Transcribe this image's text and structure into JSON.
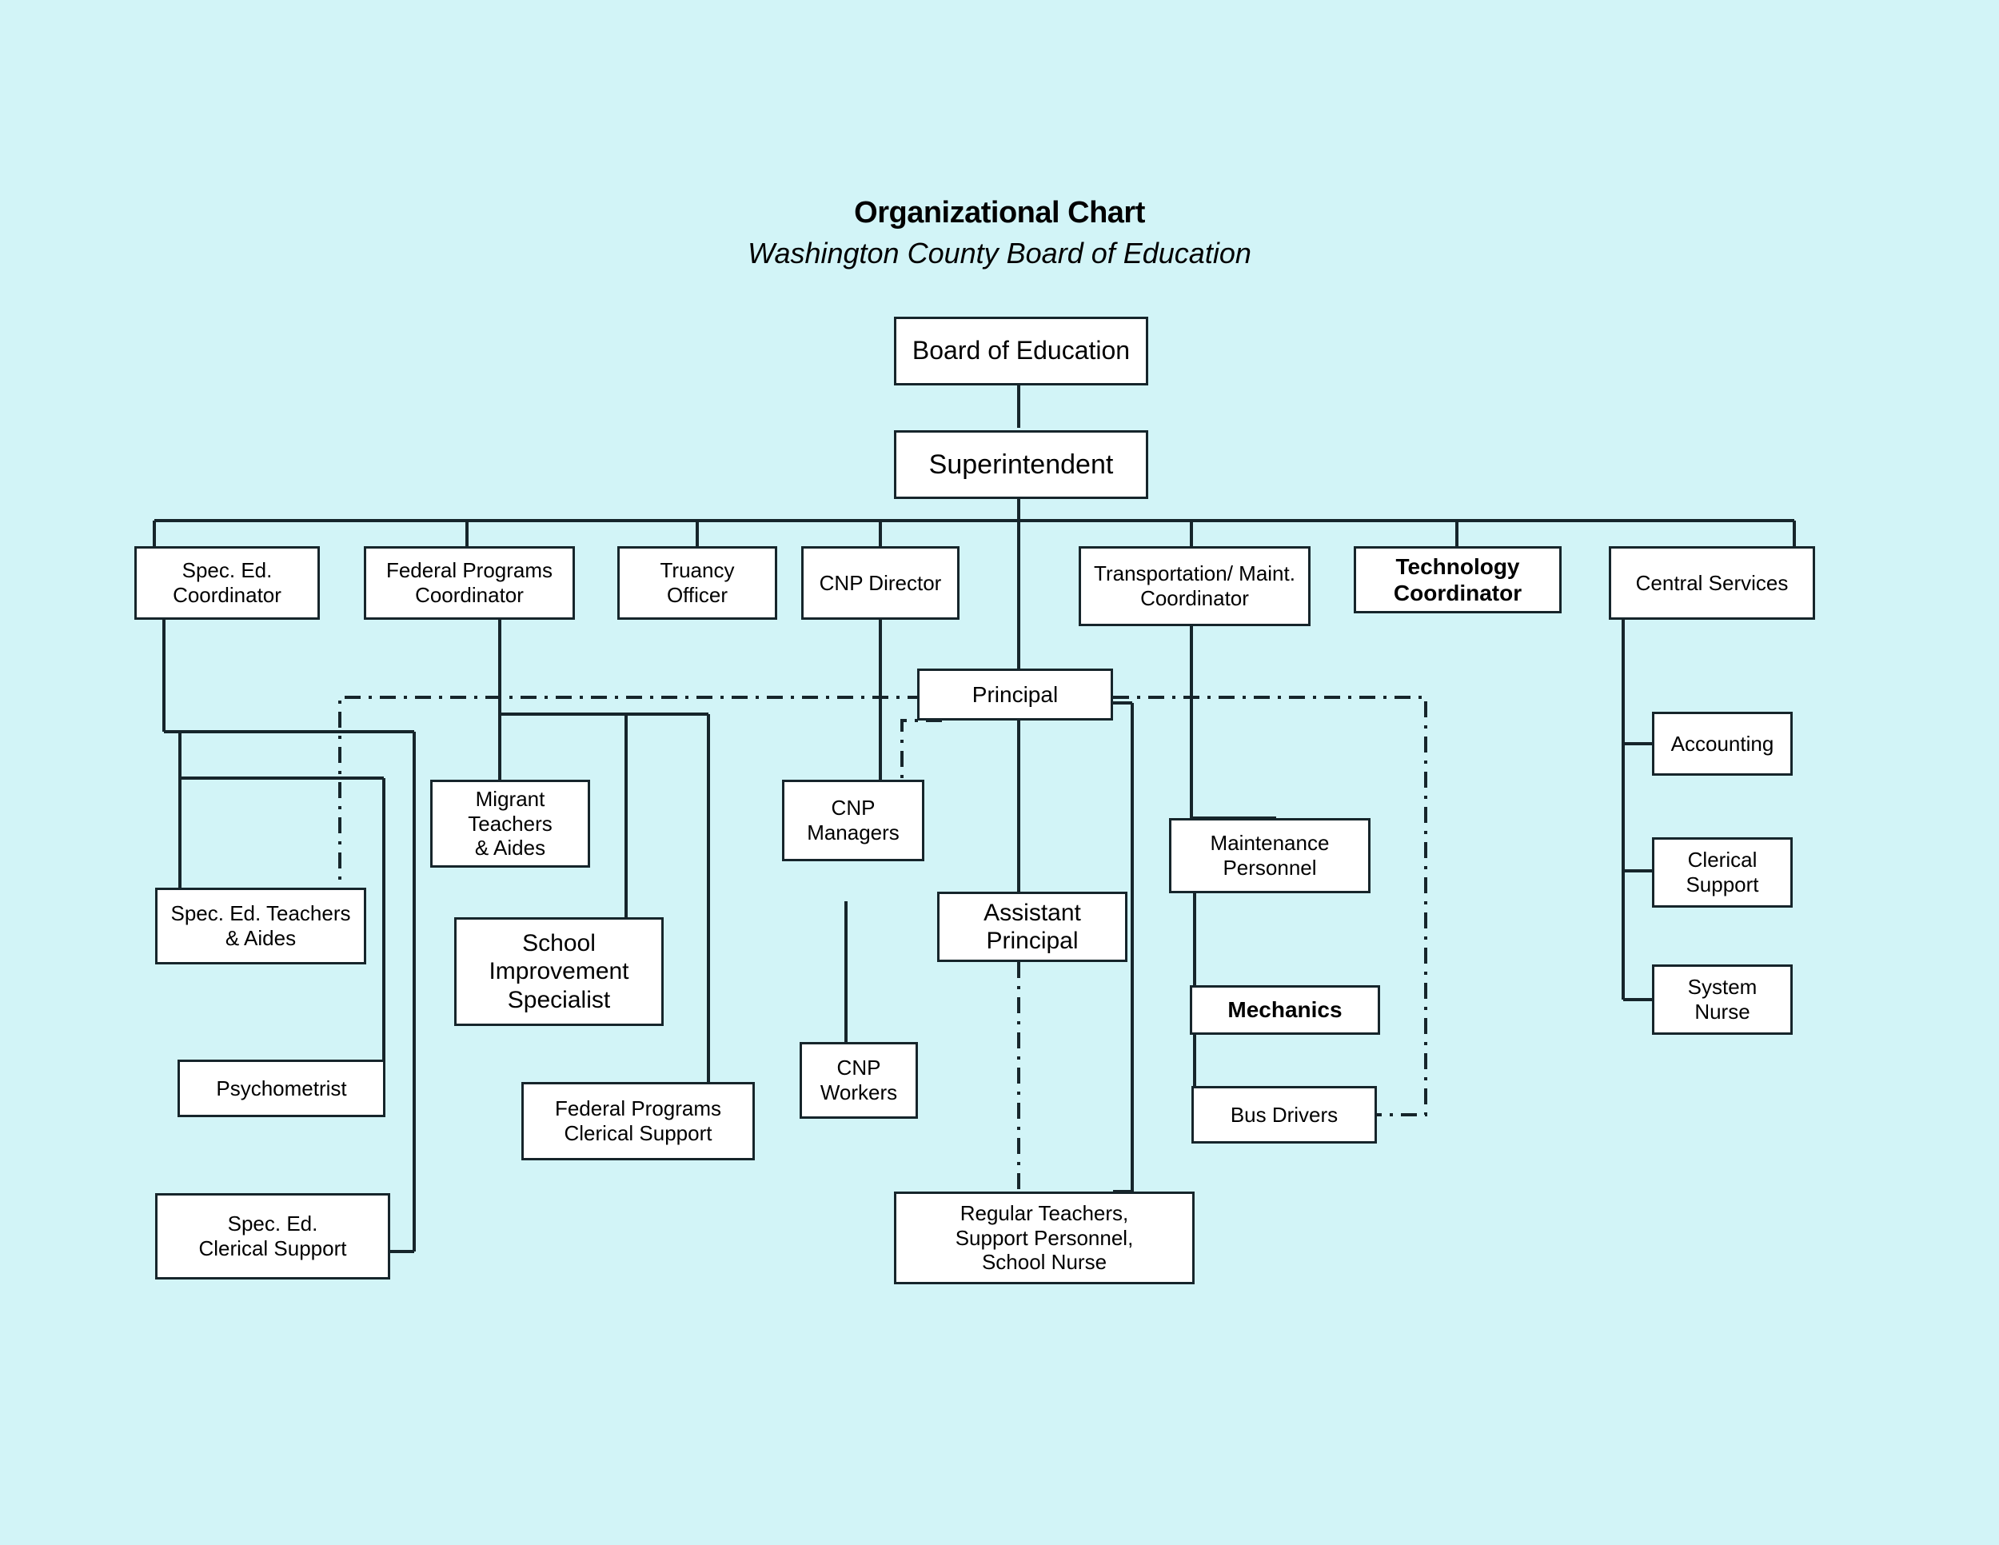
{
  "header": {
    "title": "Organizational Chart",
    "subtitle": "Washington County Board of Education"
  },
  "colors": {
    "background": "#d2f4f7",
    "node_fill": "#ffffff",
    "line": "#16252b",
    "text": "#000000"
  },
  "chart_data": {
    "type": "diagram",
    "title": "Organizational Chart",
    "subtitle": "Washington County Board of Education",
    "nodes": [
      {
        "id": "board",
        "label": "Board of Education"
      },
      {
        "id": "superintendent",
        "label": "Superintendent"
      },
      {
        "id": "spec_ed_coord",
        "label": "Spec. Ed.\nCoordinator"
      },
      {
        "id": "fed_prog_coord",
        "label": "Federal Programs\nCoordinator"
      },
      {
        "id": "truancy",
        "label": "Truancy\nOfficer"
      },
      {
        "id": "cnp_director",
        "label": "CNP Director"
      },
      {
        "id": "transport_coord",
        "label": "Transportation/ Maint.\nCoordinator"
      },
      {
        "id": "tech_coord",
        "label": "Technology\nCoordinator"
      },
      {
        "id": "central_services",
        "label": "Central Services"
      },
      {
        "id": "principal",
        "label": "Principal"
      },
      {
        "id": "spec_ed_teachers",
        "label": "Spec. Ed. Teachers\n& Aides"
      },
      {
        "id": "psychometrist",
        "label": "Psychometrist"
      },
      {
        "id": "spec_ed_clerical",
        "label": "Spec. Ed.\nClerical Support"
      },
      {
        "id": "migrant",
        "label": "Migrant\nTeachers\n& Aides"
      },
      {
        "id": "school_improve",
        "label": "School\nImprovement\nSpecialist"
      },
      {
        "id": "fed_clerical",
        "label": "Federal Programs\nClerical Support"
      },
      {
        "id": "cnp_managers",
        "label": "CNP\nManagers"
      },
      {
        "id": "cnp_workers",
        "label": "CNP\nWorkers"
      },
      {
        "id": "asst_principal",
        "label": "Assistant\nPrincipal"
      },
      {
        "id": "maintenance",
        "label": "Maintenance\nPersonnel"
      },
      {
        "id": "mechanics",
        "label": "Mechanics"
      },
      {
        "id": "bus_drivers",
        "label": "Bus Drivers"
      },
      {
        "id": "accounting",
        "label": "Accounting"
      },
      {
        "id": "clerical_support",
        "label": "Clerical\nSupport"
      },
      {
        "id": "system_nurse",
        "label": "System\nNurse"
      },
      {
        "id": "regular_teachers",
        "label": "Regular Teachers,\nSupport Personnel,\nSchool Nurse"
      }
    ],
    "edges": [
      {
        "from": "board",
        "to": "superintendent",
        "style": "solid"
      },
      {
        "from": "superintendent",
        "to": "spec_ed_coord",
        "style": "solid"
      },
      {
        "from": "superintendent",
        "to": "fed_prog_coord",
        "style": "solid"
      },
      {
        "from": "superintendent",
        "to": "truancy",
        "style": "solid"
      },
      {
        "from": "superintendent",
        "to": "cnp_director",
        "style": "solid"
      },
      {
        "from": "superintendent",
        "to": "principal",
        "style": "solid"
      },
      {
        "from": "superintendent",
        "to": "transport_coord",
        "style": "solid"
      },
      {
        "from": "superintendent",
        "to": "tech_coord",
        "style": "solid"
      },
      {
        "from": "superintendent",
        "to": "central_services",
        "style": "solid"
      },
      {
        "from": "spec_ed_coord",
        "to": "spec_ed_teachers",
        "style": "solid"
      },
      {
        "from": "spec_ed_coord",
        "to": "psychometrist",
        "style": "solid"
      },
      {
        "from": "spec_ed_coord",
        "to": "spec_ed_clerical",
        "style": "solid"
      },
      {
        "from": "fed_prog_coord",
        "to": "migrant",
        "style": "solid"
      },
      {
        "from": "fed_prog_coord",
        "to": "school_improve",
        "style": "solid"
      },
      {
        "from": "fed_prog_coord",
        "to": "fed_clerical",
        "style": "solid"
      },
      {
        "from": "cnp_director",
        "to": "cnp_managers",
        "style": "solid"
      },
      {
        "from": "cnp_managers",
        "to": "cnp_workers",
        "style": "solid"
      },
      {
        "from": "principal",
        "to": "asst_principal",
        "style": "solid"
      },
      {
        "from": "principal",
        "to": "regular_teachers",
        "style": "solid"
      },
      {
        "from": "asst_principal",
        "to": "regular_teachers",
        "style": "dash-dot"
      },
      {
        "from": "transport_coord",
        "to": "maintenance",
        "style": "solid"
      },
      {
        "from": "transport_coord",
        "to": "mechanics",
        "style": "solid"
      },
      {
        "from": "transport_coord",
        "to": "bus_drivers",
        "style": "solid"
      },
      {
        "from": "central_services",
        "to": "accounting",
        "style": "solid"
      },
      {
        "from": "central_services",
        "to": "clerical_support",
        "style": "solid"
      },
      {
        "from": "central_services",
        "to": "system_nurse",
        "style": "solid"
      },
      {
        "from": "principal",
        "to": "spec_ed_teachers",
        "style": "dash-dot"
      },
      {
        "from": "principal",
        "to": "cnp_managers",
        "style": "dash-dot"
      },
      {
        "from": "principal",
        "to": "bus_drivers",
        "style": "dash-dot"
      }
    ]
  }
}
